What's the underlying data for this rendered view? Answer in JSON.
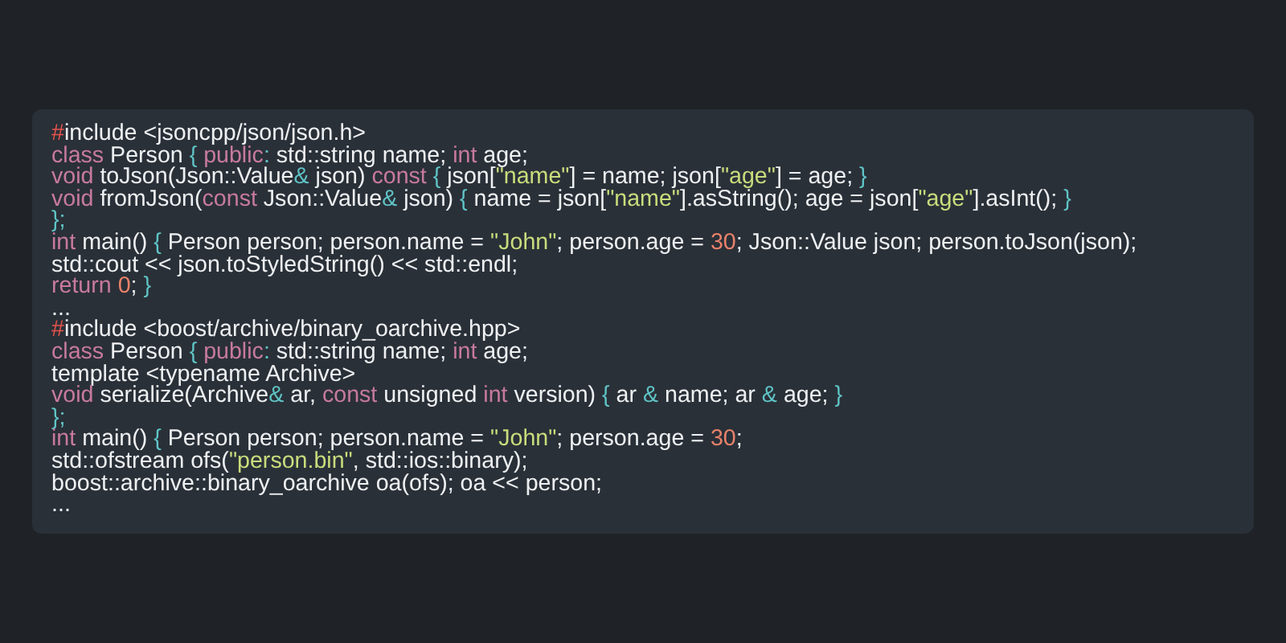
{
  "code_lines": [
    [
      {
        "text": "#",
        "kind": "hash"
      },
      {
        "text": "include <jsoncpp/json/json.h>",
        "kind": "plain"
      }
    ],
    [
      {
        "text": "class",
        "kind": "keyword"
      },
      {
        "text": " Person ",
        "kind": "plain"
      },
      {
        "text": "{",
        "kind": "punct"
      },
      {
        "text": " public",
        "kind": "keyword"
      },
      {
        "text": ":",
        "kind": "punct"
      },
      {
        "text": " std::string name; ",
        "kind": "plain"
      },
      {
        "text": "int",
        "kind": "keyword"
      },
      {
        "text": " age;",
        "kind": "plain"
      }
    ],
    [
      {
        "text": "void",
        "kind": "keyword"
      },
      {
        "text": " toJson(Json::Value",
        "kind": "plain"
      },
      {
        "text": "&",
        "kind": "punct"
      },
      {
        "text": " json) ",
        "kind": "plain"
      },
      {
        "text": "const",
        "kind": "keyword"
      },
      {
        "text": " {",
        "kind": "punct"
      },
      {
        "text": " json[",
        "kind": "plain"
      },
      {
        "text": "\"name\"",
        "kind": "string"
      },
      {
        "text": "] = name; json[",
        "kind": "plain"
      },
      {
        "text": "\"age\"",
        "kind": "string"
      },
      {
        "text": "] = age; ",
        "kind": "plain"
      },
      {
        "text": "}",
        "kind": "punct"
      }
    ],
    [
      {
        "text": "void",
        "kind": "keyword"
      },
      {
        "text": " fromJson(",
        "kind": "plain"
      },
      {
        "text": "const",
        "kind": "keyword"
      },
      {
        "text": " Json::Value",
        "kind": "plain"
      },
      {
        "text": "&",
        "kind": "punct"
      },
      {
        "text": " json) ",
        "kind": "plain"
      },
      {
        "text": "{",
        "kind": "punct"
      },
      {
        "text": " name = json[",
        "kind": "plain"
      },
      {
        "text": "\"name\"",
        "kind": "string"
      },
      {
        "text": "].asString(); age = json[",
        "kind": "plain"
      },
      {
        "text": "\"age\"",
        "kind": "string"
      },
      {
        "text": "].asInt(); ",
        "kind": "plain"
      },
      {
        "text": "}",
        "kind": "punct"
      }
    ],
    [
      {
        "text": "};",
        "kind": "punct"
      }
    ],
    [
      {
        "text": "int",
        "kind": "keyword"
      },
      {
        "text": " main() ",
        "kind": "plain"
      },
      {
        "text": "{",
        "kind": "punct"
      },
      {
        "text": " Person person; person.name = ",
        "kind": "plain"
      },
      {
        "text": "\"John\"",
        "kind": "string"
      },
      {
        "text": "; person.age = ",
        "kind": "plain"
      },
      {
        "text": "30",
        "kind": "number"
      },
      {
        "text": "; Json::Value json; person.toJson(json);",
        "kind": "plain"
      }
    ],
    [
      {
        "text": "std::cout << json.toStyledString() << std::endl;",
        "kind": "plain"
      }
    ],
    [
      {
        "text": "return",
        "kind": "keyword"
      },
      {
        "text": " 0",
        "kind": "number"
      },
      {
        "text": "; ",
        "kind": "plain"
      },
      {
        "text": "}",
        "kind": "punct"
      }
    ],
    [
      {
        "text": "...",
        "kind": "plain"
      }
    ],
    [
      {
        "text": "#",
        "kind": "hash"
      },
      {
        "text": "include <boost/archive/binary_oarchive.hpp>",
        "kind": "plain"
      }
    ],
    [
      {
        "text": "class",
        "kind": "keyword"
      },
      {
        "text": " Person ",
        "kind": "plain"
      },
      {
        "text": "{",
        "kind": "punct"
      },
      {
        "text": " public",
        "kind": "keyword"
      },
      {
        "text": ":",
        "kind": "punct"
      },
      {
        "text": " std::string name; ",
        "kind": "plain"
      },
      {
        "text": "int",
        "kind": "keyword"
      },
      {
        "text": " age;",
        "kind": "plain"
      }
    ],
    [
      {
        "text": "template <typename Archive>",
        "kind": "plain"
      }
    ],
    [
      {
        "text": "void",
        "kind": "keyword"
      },
      {
        "text": " serialize(Archive",
        "kind": "plain"
      },
      {
        "text": "&",
        "kind": "punct"
      },
      {
        "text": " ar, ",
        "kind": "plain"
      },
      {
        "text": "const",
        "kind": "keyword"
      },
      {
        "text": " unsigned ",
        "kind": "plain"
      },
      {
        "text": "int",
        "kind": "keyword"
      },
      {
        "text": " version) ",
        "kind": "plain"
      },
      {
        "text": "{",
        "kind": "punct"
      },
      {
        "text": " ar ",
        "kind": "plain"
      },
      {
        "text": "&",
        "kind": "punct"
      },
      {
        "text": " name; ar ",
        "kind": "plain"
      },
      {
        "text": "&",
        "kind": "punct"
      },
      {
        "text": " age; ",
        "kind": "plain"
      },
      {
        "text": "}",
        "kind": "punct"
      }
    ],
    [
      {
        "text": "};",
        "kind": "punct"
      }
    ],
    [
      {
        "text": "int",
        "kind": "keyword"
      },
      {
        "text": " main() ",
        "kind": "plain"
      },
      {
        "text": "{",
        "kind": "punct"
      },
      {
        "text": " Person person; person.name = ",
        "kind": "plain"
      },
      {
        "text": "\"John\"",
        "kind": "string"
      },
      {
        "text": "; person.age = ",
        "kind": "plain"
      },
      {
        "text": "30",
        "kind": "number"
      },
      {
        "text": ";",
        "kind": "plain"
      }
    ],
    [
      {
        "text": "std::ofstream ofs(",
        "kind": "plain"
      },
      {
        "text": "\"person.bin\"",
        "kind": "string"
      },
      {
        "text": ", std::ios::binary);",
        "kind": "plain"
      }
    ],
    [
      {
        "text": "boost::archive::binary_oarchive oa(ofs); oa << person;",
        "kind": "plain"
      }
    ],
    [
      {
        "text": "...",
        "kind": "plain"
      }
    ]
  ]
}
